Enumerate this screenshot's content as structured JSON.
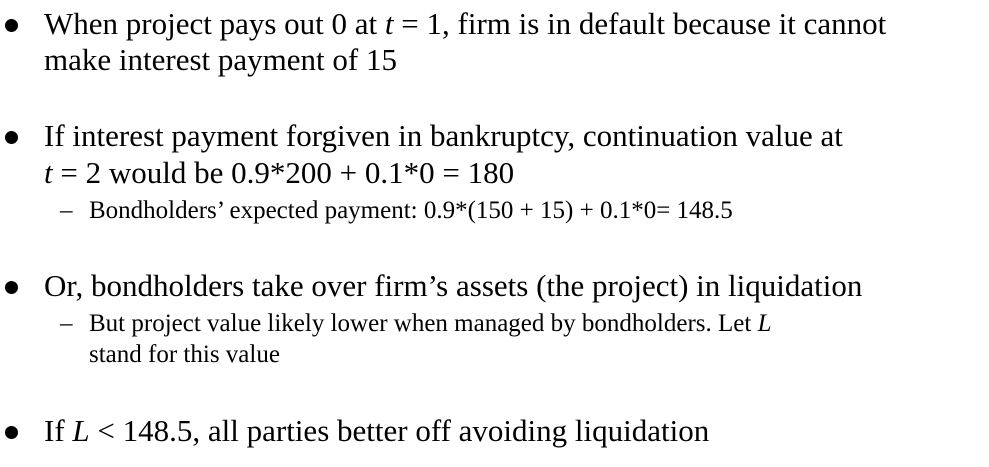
{
  "bullets": [
    {
      "line1": {
        "a": "When project pays out 0 at ",
        "var": "t",
        "b": " = 1, firm is in default because it cannot"
      },
      "line2": "make interest payment of 15"
    },
    {
      "line1": "If interest payment forgiven in bankruptcy, continuation value at",
      "line2": {
        "var": "t",
        "b": " = 2 would be 0.9*200 + 0.1*0 = 180"
      },
      "sub": {
        "dash": "–",
        "text": "Bondholders’ expected payment: 0.9*(150 + 15) + 0.1*0= 148.5"
      }
    },
    {
      "line1": "Or, bondholders take over firm’s assets (the project) in liquidation",
      "sub": {
        "dash": "–",
        "line1": {
          "a": "But project value likely lower when managed by bondholders. Let ",
          "var": "L"
        },
        "line2": "stand for this value"
      }
    },
    {
      "line1": {
        "a": "If ",
        "var": "L",
        "b": " < 148.5, all parties better off avoiding liquidation"
      }
    }
  ]
}
